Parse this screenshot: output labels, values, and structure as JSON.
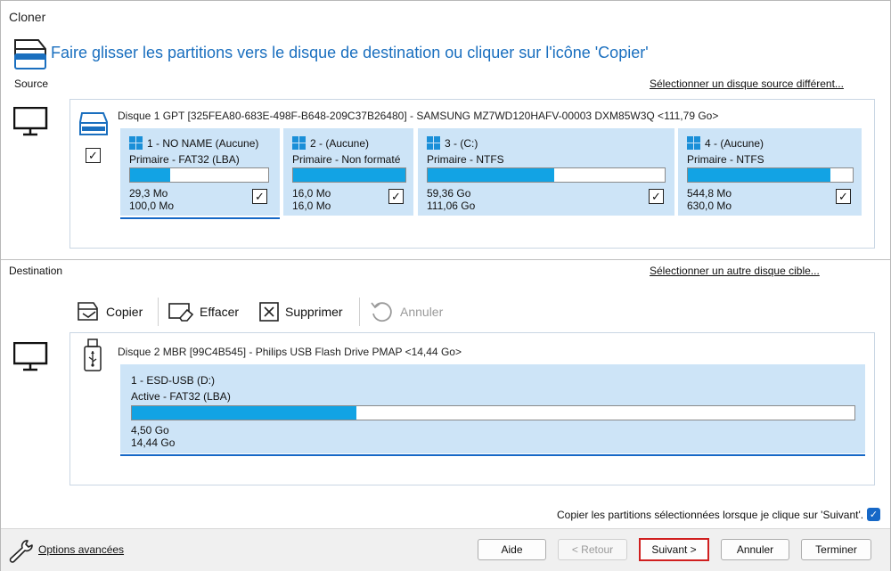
{
  "window": {
    "title": "Cloner"
  },
  "header": {
    "headline": "Faire glisser les partitions vers le disque de destination ou cliquer sur l'icône  'Copier'"
  },
  "source": {
    "label": "Source",
    "change_link": "Sélectionner un disque source différent...",
    "disk_info": "Disque 1 GPT [325FEA80-683E-498F-B648-209C37B26480] - SAMSUNG MZ7WD120HAFV-00003 DXM85W3Q  <111,79 Go>",
    "disk_checked": true,
    "partitions": [
      {
        "title": "1 - NO NAME (Aucune)",
        "type": "Primaire - FAT32 (LBA)",
        "used": "29,3 Mo",
        "total": "100,0 Mo",
        "fill": 0.293,
        "checked": true,
        "selected": true
      },
      {
        "title": "2 -  (Aucune)",
        "type": "Primaire - Non formaté",
        "used": "16,0 Mo",
        "total": "16,0 Mo",
        "fill": 1.0,
        "checked": true,
        "selected": false
      },
      {
        "title": "3 -  (C:)",
        "type": "Primaire - NTFS",
        "used": "59,36 Go",
        "total": "111,06 Go",
        "fill": 0.535,
        "checked": true,
        "selected": false
      },
      {
        "title": "4 -  (Aucune)",
        "type": "Primaire - NTFS",
        "used": "544,8 Mo",
        "total": "630,0 Mo",
        "fill": 0.865,
        "checked": true,
        "selected": false
      }
    ]
  },
  "destination": {
    "label": "Destination",
    "change_link": "Sélectionner un autre disque cible...",
    "toolbar": {
      "copy": "Copier",
      "erase": "Effacer",
      "delete": "Supprimer",
      "undo": "Annuler"
    },
    "disk_info": "Disque 2 MBR [99C4B545] - Philips  USB Flash Drive  PMAP  <14,44 Go>",
    "partition": {
      "title": "1 - ESD-USB (D:)",
      "type": "Active - FAT32 (LBA)",
      "used": "4,50 Go",
      "total": "14,44 Go",
      "fill": 0.311
    }
  },
  "options": {
    "copy_on_next": "Copier les partitions sélectionnées lorsque je clique sur 'Suivant'.",
    "copy_on_next_checked": true
  },
  "footer": {
    "advanced": "Options avancées",
    "help": "Aide",
    "back": "< Retour",
    "next": "Suivant >",
    "cancel": "Annuler",
    "finish": "Terminer"
  },
  "colors": {
    "accent": "#1668c7",
    "headline": "#1a6fbf",
    "partition_bg": "#cde4f7",
    "bar_fill": "#12a3e4",
    "highlight": "#d01f1f"
  }
}
